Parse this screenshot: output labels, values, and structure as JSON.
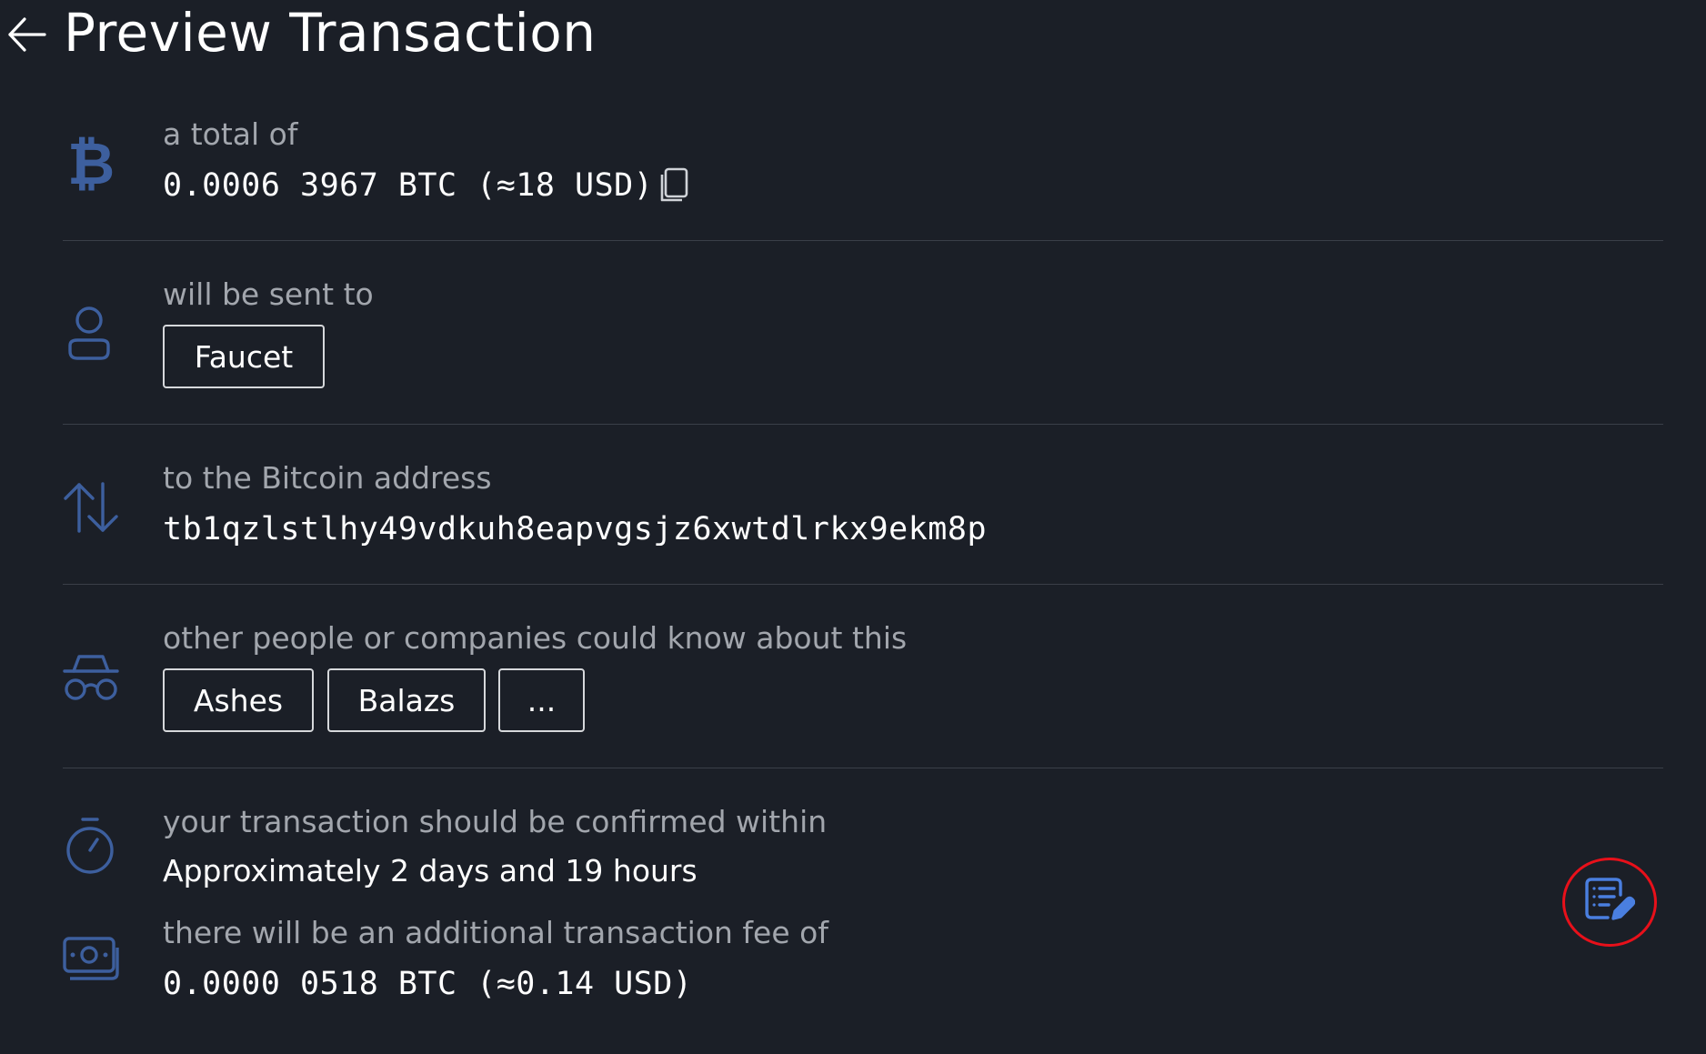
{
  "header": {
    "title": "Preview Transaction"
  },
  "amount": {
    "label": "a total of",
    "value": "0.0006 3967 BTC (≈18 USD)"
  },
  "recipient": {
    "label": "will be sent to",
    "chip": "Faucet"
  },
  "address": {
    "label": "to the Bitcoin address",
    "value": "tb1qzlstlhy49vdkuh8eapvgsjz6xwtdlrkx9ekm8p"
  },
  "privacy": {
    "label": "other people or companies could know about this",
    "chips": [
      "Ashes",
      "Balazs",
      "..."
    ]
  },
  "confirmation": {
    "label": "your transaction should be confirmed within",
    "value": "Approximately 2 days and 19 hours"
  },
  "fee": {
    "label": "there will be an additional transaction fee of",
    "value": "0.0000 0518 BTC (≈0.14 USD)"
  },
  "colors": {
    "background": "#1b1f27",
    "icon_blue": "#3d5f9e",
    "fab_blue": "#4a7fe0",
    "highlight_red": "#e8101a"
  },
  "icons": {
    "back": "arrow-left-icon",
    "amount": "bitcoin-icon",
    "copy": "copy-icon",
    "recipient": "user-icon",
    "address": "arrows-up-down-icon",
    "privacy": "spy-glasses-icon",
    "confirmation": "stopwatch-icon",
    "fee": "banknote-icon",
    "fab": "edit-document-icon"
  }
}
